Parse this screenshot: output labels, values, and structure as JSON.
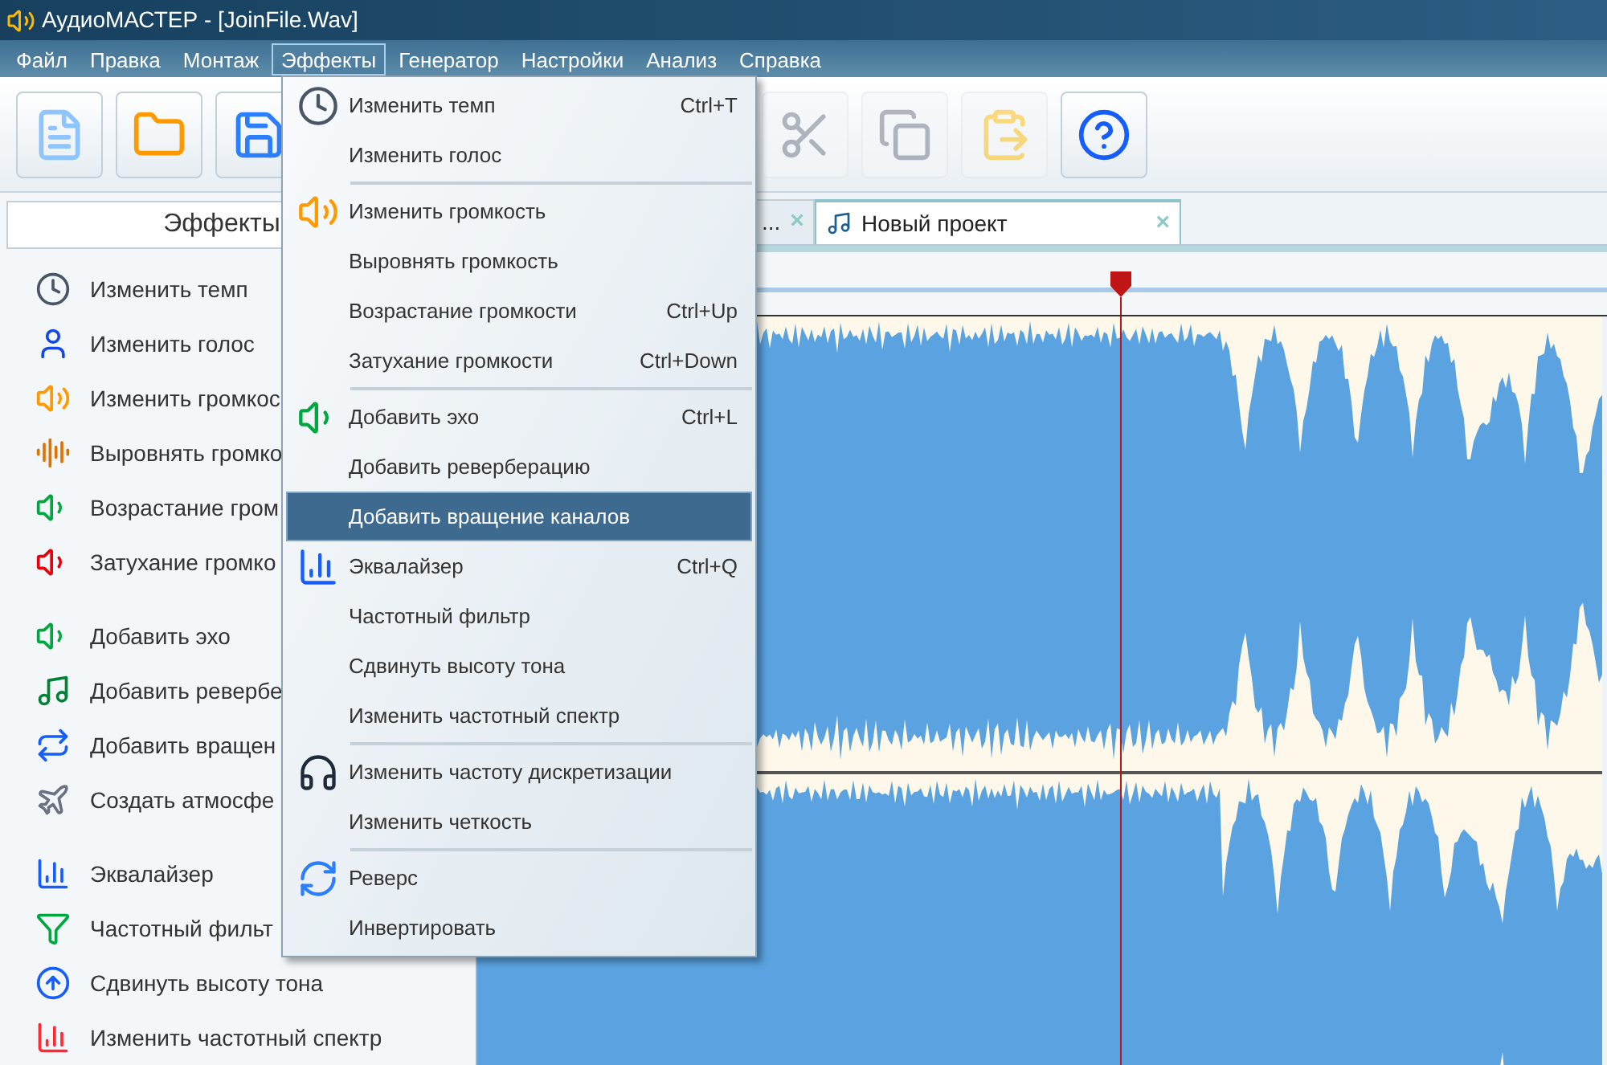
{
  "window": {
    "title": "АудиоМАСТЕР - [JoinFile.Wav]"
  },
  "menu_bar": [
    {
      "label": "Файл",
      "selected": false
    },
    {
      "label": "Правка",
      "selected": false
    },
    {
      "label": "Монтаж",
      "selected": false
    },
    {
      "label": "Эффекты",
      "selected": true
    },
    {
      "label": "Генератор",
      "selected": false
    },
    {
      "label": "Настройки",
      "selected": false
    },
    {
      "label": "Анализ",
      "selected": false
    },
    {
      "label": "Справка",
      "selected": false
    }
  ],
  "toolbar": [
    {
      "kind": "new",
      "disabled": false
    },
    {
      "kind": "open",
      "disabled": false
    },
    {
      "kind": "save",
      "disabled": false
    },
    {
      "kind": "cut",
      "disabled": true
    },
    {
      "kind": "copy",
      "disabled": true
    },
    {
      "kind": "paste",
      "disabled": true
    },
    {
      "kind": "help",
      "disabled": false
    }
  ],
  "side_panel": {
    "title": "Эффекты",
    "groups": [
      [
        {
          "label": "Изменить темп",
          "kind": "clock"
        },
        {
          "label": "Изменить голос",
          "kind": "person"
        },
        {
          "label": "Изменить громкос",
          "kind": "volume"
        },
        {
          "label": "Выровнять громко",
          "kind": "level"
        },
        {
          "label": "Возрастание гром",
          "kind": "fadein"
        },
        {
          "label": "Затухание громко",
          "kind": "fadeout"
        }
      ],
      [
        {
          "label": "Добавить эхо",
          "kind": "echo"
        },
        {
          "label": "Добавить ревербе",
          "kind": "reverb"
        },
        {
          "label": "Добавить вращен",
          "kind": "rotate"
        },
        {
          "label": "Создать атмосфе",
          "kind": "atmosphere"
        }
      ],
      [
        {
          "label": "Эквалайзер",
          "kind": "eq"
        },
        {
          "label": "Частотный фильт",
          "kind": "filter"
        },
        {
          "label": "Сдвинуть высоту тона",
          "kind": "pitch"
        },
        {
          "label": "Изменить частотный спектр",
          "kind": "spectrum"
        }
      ]
    ]
  },
  "tabs": [
    {
      "label": "...",
      "close": "×",
      "selected": false
    },
    {
      "label": "Новый проект",
      "close": "×",
      "selected": true
    }
  ],
  "effects_menu": [
    {
      "kind": "clock",
      "label": "Изменить темп",
      "shortcut": "Ctrl+T",
      "selected": false
    },
    {
      "kind": "item",
      "label": "Изменить голос",
      "selected": false
    },
    {
      "kind": "separator"
    },
    {
      "kind": "volume",
      "label": "Изменить громкость",
      "selected": false
    },
    {
      "kind": "item",
      "label": "Выровнять громкость",
      "selected": false
    },
    {
      "kind": "item",
      "label": "Возрастание громкости",
      "shortcut": "Ctrl+Up",
      "selected": false
    },
    {
      "kind": "item",
      "label": "Затухание громкости",
      "shortcut": "Ctrl+Down",
      "selected": false
    },
    {
      "kind": "separator"
    },
    {
      "kind": "echo",
      "label": "Добавить эхо",
      "shortcut": "Ctrl+L",
      "selected": false
    },
    {
      "kind": "item",
      "label": "Добавить реверберацию",
      "selected": false
    },
    {
      "kind": "item",
      "label": "Добавить вращение каналов",
      "selected": true
    },
    {
      "kind": "eq",
      "label": "Эквалайзер",
      "shortcut": "Ctrl+Q",
      "selected": false
    },
    {
      "kind": "item",
      "label": "Частотный фильтр",
      "selected": false
    },
    {
      "kind": "item",
      "label": "Сдвинуть высоту тона",
      "selected": false
    },
    {
      "kind": "item",
      "label": "Изменить частотный спектр",
      "selected": false
    },
    {
      "kind": "separator"
    },
    {
      "kind": "headphones",
      "label": "Изменить частоту дискретизации",
      "selected": false
    },
    {
      "kind": "item",
      "label": "Изменить четкость",
      "selected": false
    },
    {
      "kind": "separator"
    },
    {
      "kind": "reverse",
      "label": "Реверс",
      "selected": false
    },
    {
      "kind": "item",
      "label": "Инвертировать",
      "selected": false
    }
  ]
}
